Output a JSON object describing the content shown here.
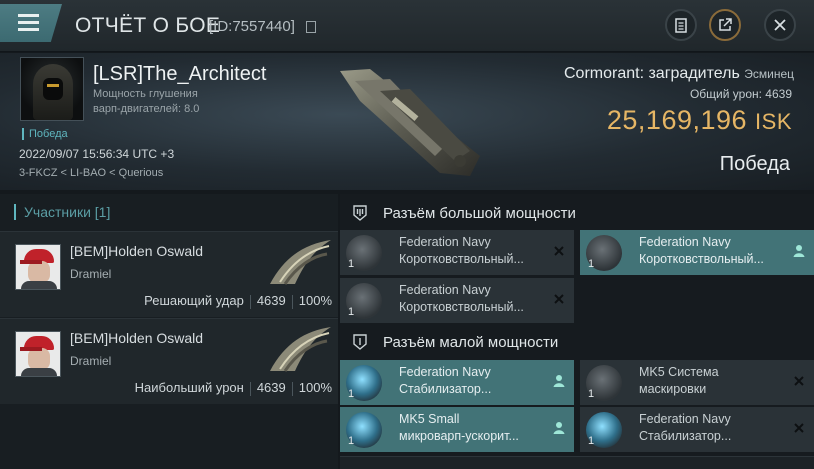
{
  "header": {
    "title": "ОТЧЁТ О БОЕ",
    "id": "[ID:7557440]",
    "icons": [
      "menu-icon",
      "copy-icon",
      "clipboard-icon",
      "share-icon",
      "close-icon"
    ]
  },
  "summary": {
    "pilot": "[LSR]The_Architect",
    "line1": "Мощность глушения",
    "line2": "варп-двигателей: 8.0",
    "victory_tag": "Победа",
    "datetime": "2022/09/07 15:56:34 UTC +3",
    "location": "3-FKCZ < LI-BAO < Querious",
    "ship": "Cormorant: заградитель",
    "ship_class": "Эсминец",
    "total_damage_label": "Общий урон:",
    "total_damage": "4639",
    "isk_value": "25,169,196",
    "isk_unit": "ISK",
    "result": "Победа"
  },
  "participants": {
    "header": "Участники [1]",
    "rows": [
      {
        "name": "[BEM]Holden Oswald",
        "ship": "Dramiel",
        "role": "Решающий удар",
        "damage": "4639",
        "percent": "100%"
      },
      {
        "name": "[BEM]Holden Oswald",
        "ship": "Dramiel",
        "role": "Наибольший урон",
        "damage": "4639",
        "percent": "100%"
      }
    ]
  },
  "slots": {
    "high_label": "Разъём большой мощности",
    "low_label": "Разъём малой мощности",
    "high": [
      {
        "name1": "Federation Navy",
        "name2": "Коротковствольный...",
        "qty": "1",
        "state": "destroyed"
      },
      {
        "name1": "Federation Navy",
        "name2": "Коротковствольный...",
        "qty": "1",
        "state": "dropped"
      },
      {
        "name1": "Federation Navy",
        "name2": "Коротковствольный...",
        "qty": "1",
        "state": "destroyed"
      }
    ],
    "low": [
      {
        "name1": "Federation Navy",
        "name2": "Стабилизатор...",
        "qty": "1",
        "state": "dropped"
      },
      {
        "name1": "MK5 Система",
        "name2": "маскировки",
        "qty": "1",
        "state": "destroyed"
      },
      {
        "name1": "MK5 Small",
        "name2": "микроварп-ускорит...",
        "qty": "1",
        "state": "dropped"
      },
      {
        "name1": "Federation Navy",
        "name2": "Стабилизатор...",
        "qty": "1",
        "state": "destroyed"
      }
    ]
  },
  "colors": {
    "accent": "#5fb6bf",
    "isk": "#e6b665",
    "dropped": "#427377"
  }
}
